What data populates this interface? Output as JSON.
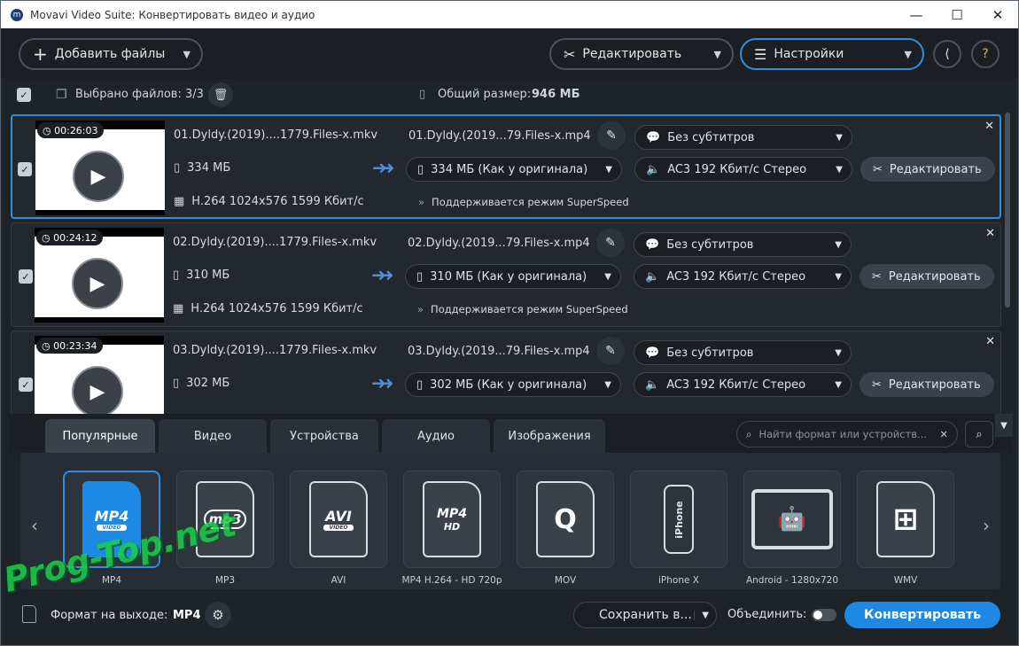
{
  "window": {
    "title": "Movavi Video Suite: Конвертировать видео и аудио",
    "controls": {
      "minimize": "—",
      "maximize": "☐",
      "close": "✕"
    }
  },
  "toolbar": {
    "add_files": "Добавить файлы",
    "edit": "Редактировать",
    "settings": "Настройки"
  },
  "selection": {
    "label": "Выбрано файлов: 3/3",
    "total_label": "Общий размер:",
    "total_value": "946 МБ"
  },
  "files": [
    {
      "duration": "00:26:03",
      "name": "01.Dyldy.(2019)....1779.Files-x.mkv",
      "size": "334 МБ",
      "codec": "H.264 1024x576 1599 Кбит/с",
      "out_name": "01.Dyldy.(2019...79.Files-x.mp4",
      "out_size": "334 МБ (Как у оригинала)",
      "superspeed": "Поддерживается режим SuperSpeed",
      "subtitles": "Без субтитров",
      "audio": "AC3 192 Кбит/с Стерео",
      "edit": "Редактировать"
    },
    {
      "duration": "00:24:12",
      "name": "02.Dyldy.(2019)....1779.Files-x.mkv",
      "size": "310 МБ",
      "codec": "H.264 1024x576 1599 Кбит/с",
      "out_name": "02.Dyldy.(2019...79.Files-x.mp4",
      "out_size": "310 МБ (Как у оригинала)",
      "superspeed": "Поддерживается режим SuperSpeed",
      "subtitles": "Без субтитров",
      "audio": "AC3 192 Кбит/с Стерео",
      "edit": "Редактировать"
    },
    {
      "duration": "00:23:34",
      "name": "03.Dyldy.(2019)....1779.Files-x.mkv",
      "size": "302 МБ",
      "codec": "",
      "out_name": "03.Dyldy.(2019...79.Files-x.mp4",
      "out_size": "302 МБ (Как у оригинала)",
      "superspeed": "",
      "subtitles": "Без субтитров",
      "audio": "AC3 192 Кбит/с Стерео",
      "edit": "Редактировать"
    }
  ],
  "tabs": [
    "Популярные",
    "Видео",
    "Устройства",
    "Аудио",
    "Изображения"
  ],
  "search": {
    "placeholder": "Найти формат или устройств..."
  },
  "formats": [
    {
      "label": "MP4",
      "icon_text": "MP4",
      "sub": "VIDEO"
    },
    {
      "label": "MP3",
      "icon_text": "mp3",
      "sub": ""
    },
    {
      "label": "AVI",
      "icon_text": "AVI",
      "sub": "VIDEO"
    },
    {
      "label": "MP4 H.264 - HD 720p",
      "icon_text": "MP4",
      "sub": "HD"
    },
    {
      "label": "MOV",
      "icon_text": "Q",
      "sub": ""
    },
    {
      "label": "iPhone X",
      "icon_text": "iPhone",
      "sub": ""
    },
    {
      "label": "Android - 1280x720",
      "icon_text": "🤖",
      "sub": ""
    },
    {
      "label": "WMV",
      "icon_text": "⊞",
      "sub": ""
    }
  ],
  "footer": {
    "output_label": "Формат на выходе:",
    "output_value": "MP4",
    "save": "Сохранить в...",
    "merge": "Объединить:",
    "convert": "Конвертировать"
  },
  "watermark": "Prog-Top.net",
  "colors": {
    "accent": "#1e88e5",
    "selected_border": "#2f8ee0",
    "background": "#1e2328"
  }
}
